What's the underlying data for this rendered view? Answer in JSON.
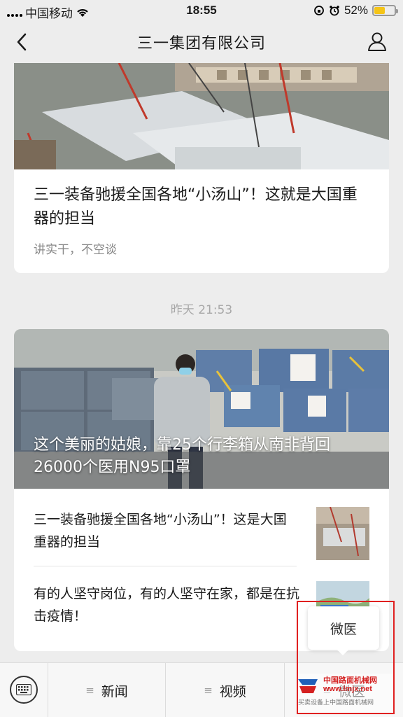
{
  "status_bar": {
    "carrier": "中国移动",
    "time": "18:55",
    "battery": "52%",
    "battery_level": 0.52
  },
  "nav": {
    "title": "三一集团有限公司"
  },
  "article1": {
    "title": "三一装备驰援全国各地“小汤山”！这就是大国重器的担当",
    "subtitle": "讲实干，不空谈"
  },
  "timestamp": "昨天 21:53",
  "article2": {
    "hero_title": "这个美丽的姑娘，靠25个行李箱从南非背回26000个医用N95口罩",
    "items": [
      {
        "title": "三一装备驰援全国各地“小汤山”！这是大国重器的担当"
      },
      {
        "title": "有的人坚守岗位，有的人坚守在家，都是在抗击疫情！"
      }
    ]
  },
  "tab_bar": {
    "tabs": [
      {
        "label": "新闻"
      },
      {
        "label": "视频"
      },
      {
        "label": "微医"
      }
    ]
  },
  "popup": {
    "label": "微医"
  },
  "watermark": {
    "site_name": "中国路面机械网",
    "site_url": "www.lmjx.net",
    "slogan": "买卖设备上中国路面机械网"
  },
  "colors": {
    "background": "#ededed",
    "battery": "#f5c518",
    "highlight": "#e02020"
  }
}
